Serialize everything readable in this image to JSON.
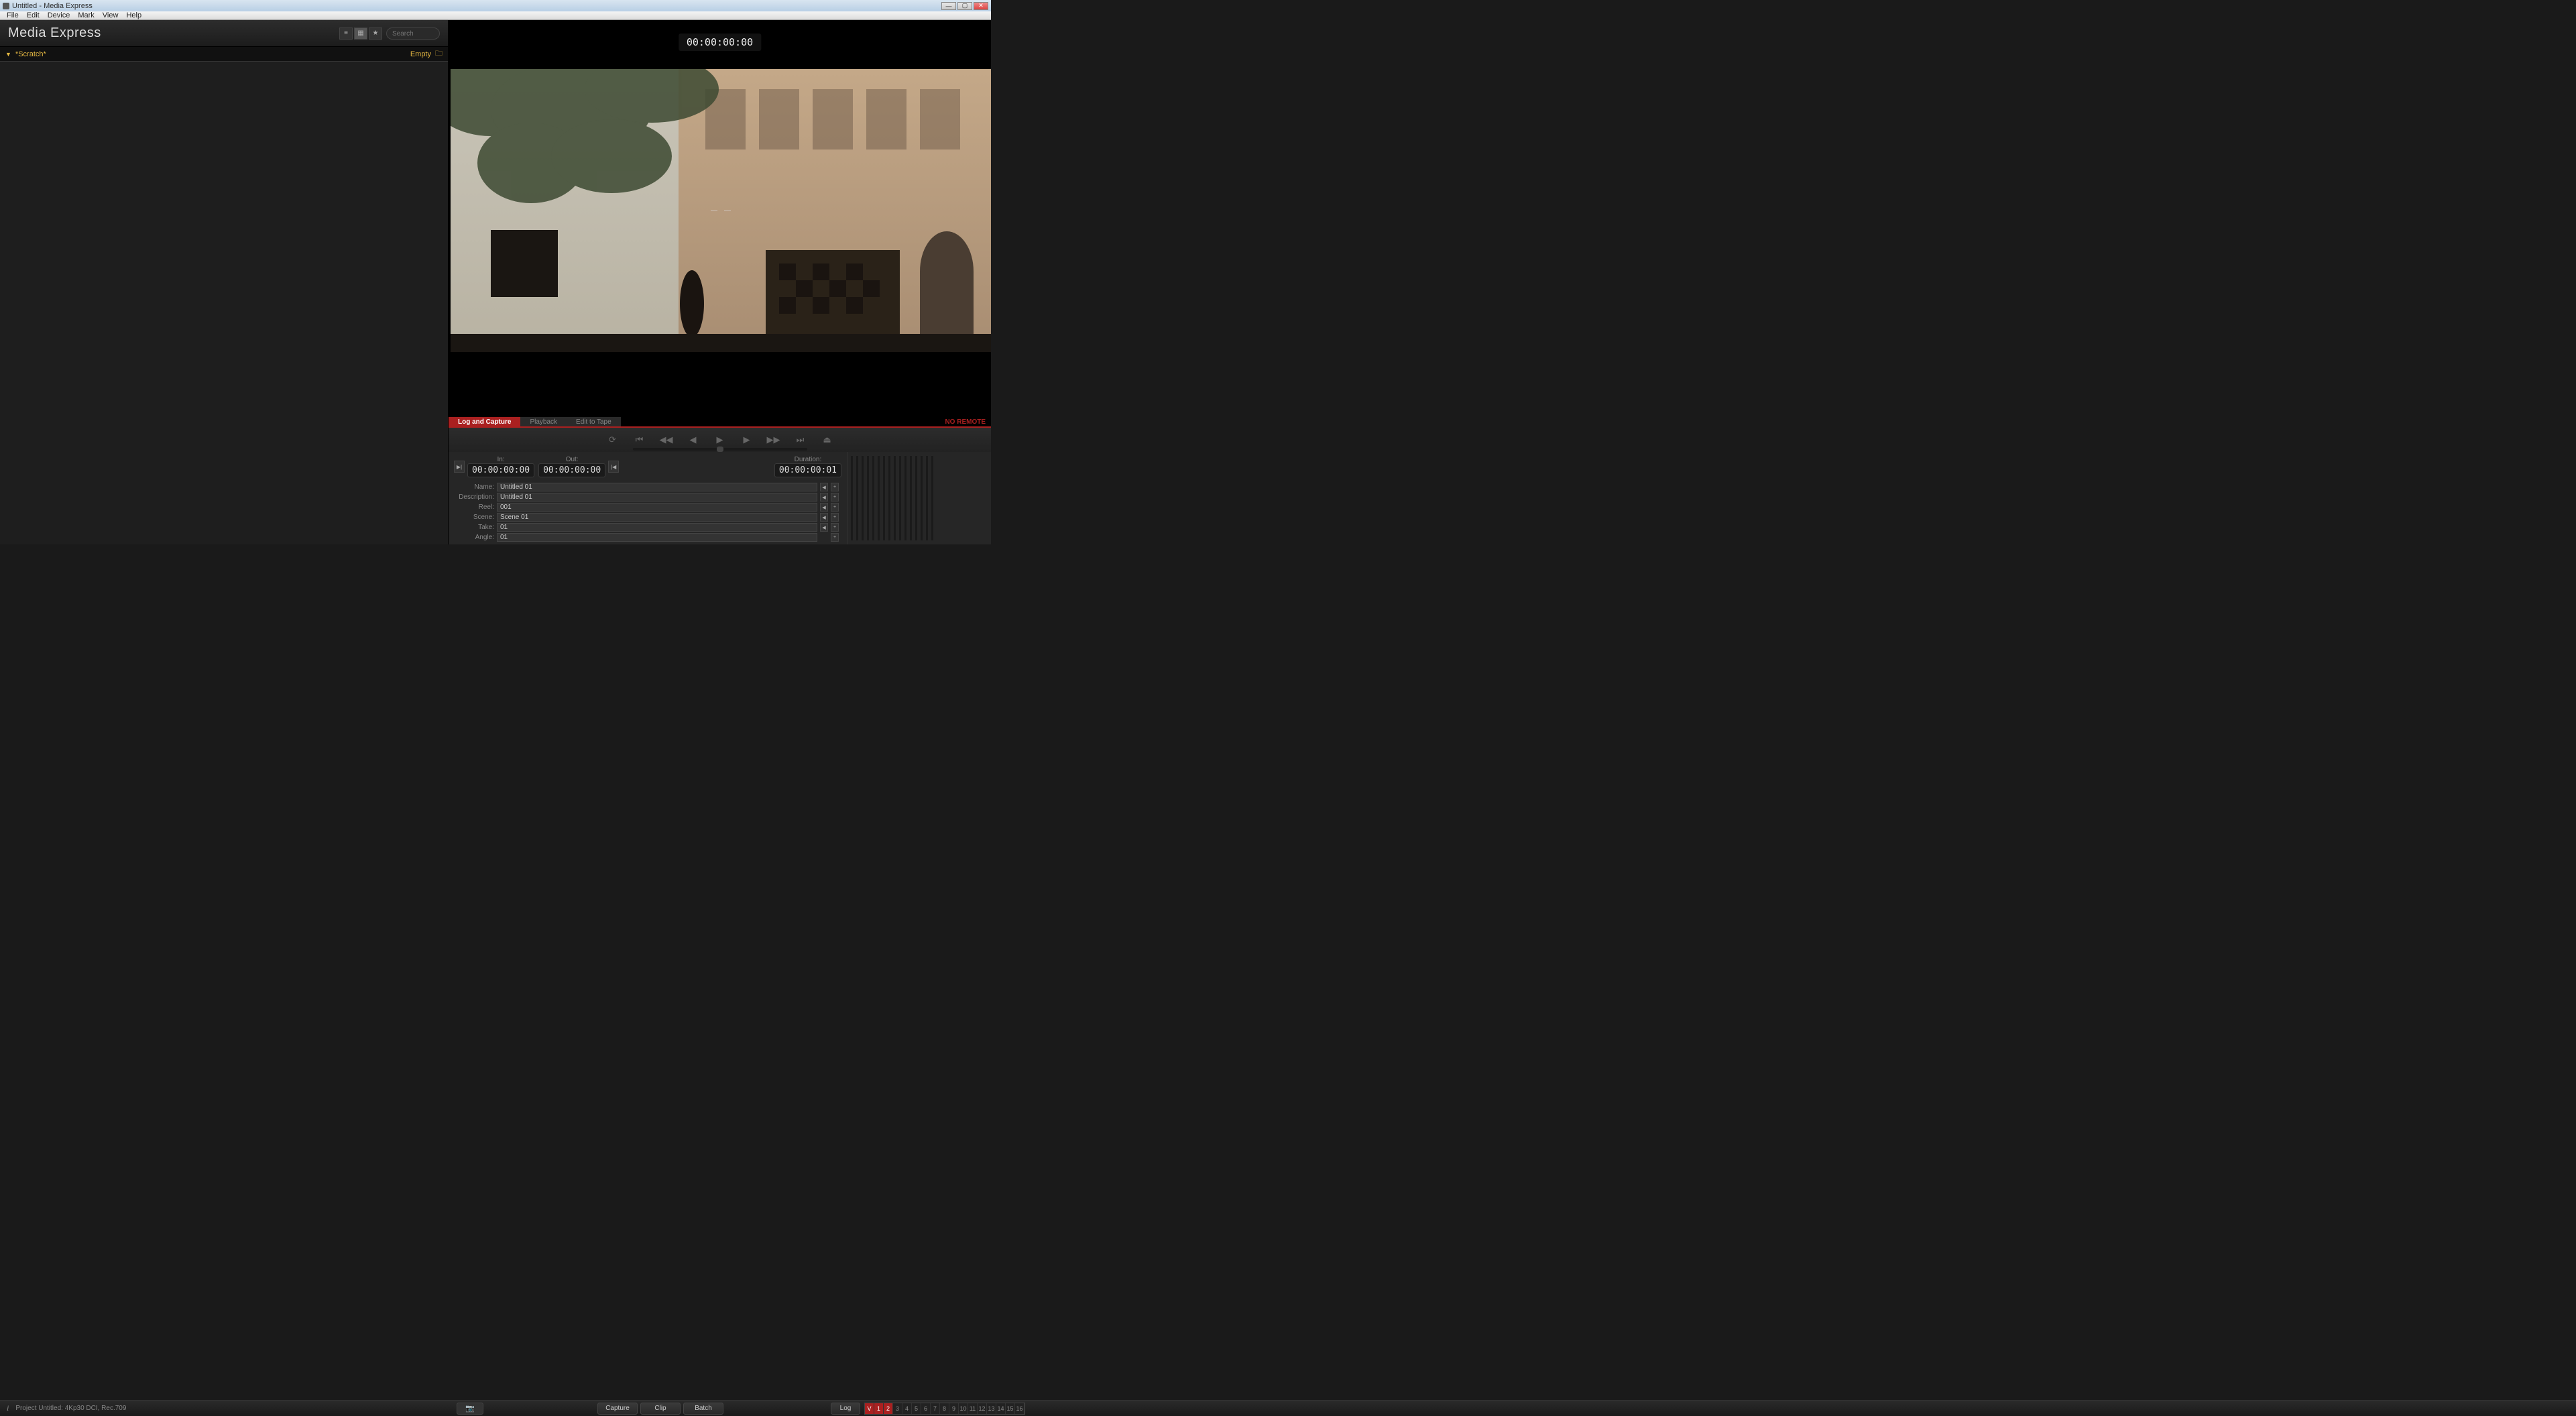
{
  "window": {
    "title": "Untitled - Media Express"
  },
  "menu": {
    "file": "File",
    "edit": "Edit",
    "device": "Device",
    "mark": "Mark",
    "view": "View",
    "help": "Help"
  },
  "sidebar": {
    "app_title": "Media Express",
    "search_placeholder": "Search",
    "bin_name": "*Scratch*",
    "bin_status": "Empty"
  },
  "preview": {
    "timecode": "00:00:00:00"
  },
  "modes": {
    "log_capture": "Log and Capture",
    "playback": "Playback",
    "edit_to_tape": "Edit to Tape",
    "no_remote": "NO REMOTE"
  },
  "inout": {
    "in_label": "In:",
    "out_label": "Out:",
    "duration_label": "Duration:",
    "in_tc": "00:00:00:00",
    "out_tc": "00:00:00:00",
    "duration_tc": "00:00:00:01"
  },
  "log": {
    "name_label": "Name:",
    "name_value": "Untitled 01",
    "description_label": "Description:",
    "description_value": "Untitled 01",
    "reel_label": "Reel:",
    "reel_value": "001",
    "scene_label": "Scene:",
    "scene_value": "Scene 01",
    "take_label": "Take:",
    "take_value": "01",
    "angle_label": "Angle:",
    "angle_value": "01"
  },
  "buttons": {
    "capture": "Capture",
    "clip": "Clip",
    "batch": "Batch",
    "log": "Log"
  },
  "tracks": {
    "items": [
      "V",
      "1",
      "2",
      "3",
      "4",
      "5",
      "6",
      "7",
      "8",
      "9",
      "10",
      "11",
      "12",
      "13",
      "14",
      "15",
      "16"
    ],
    "enabled": [
      "V",
      "1",
      "2"
    ]
  },
  "status": {
    "project_info": "Project Untitled: 4Kp30 DCI, Rec.709"
  }
}
